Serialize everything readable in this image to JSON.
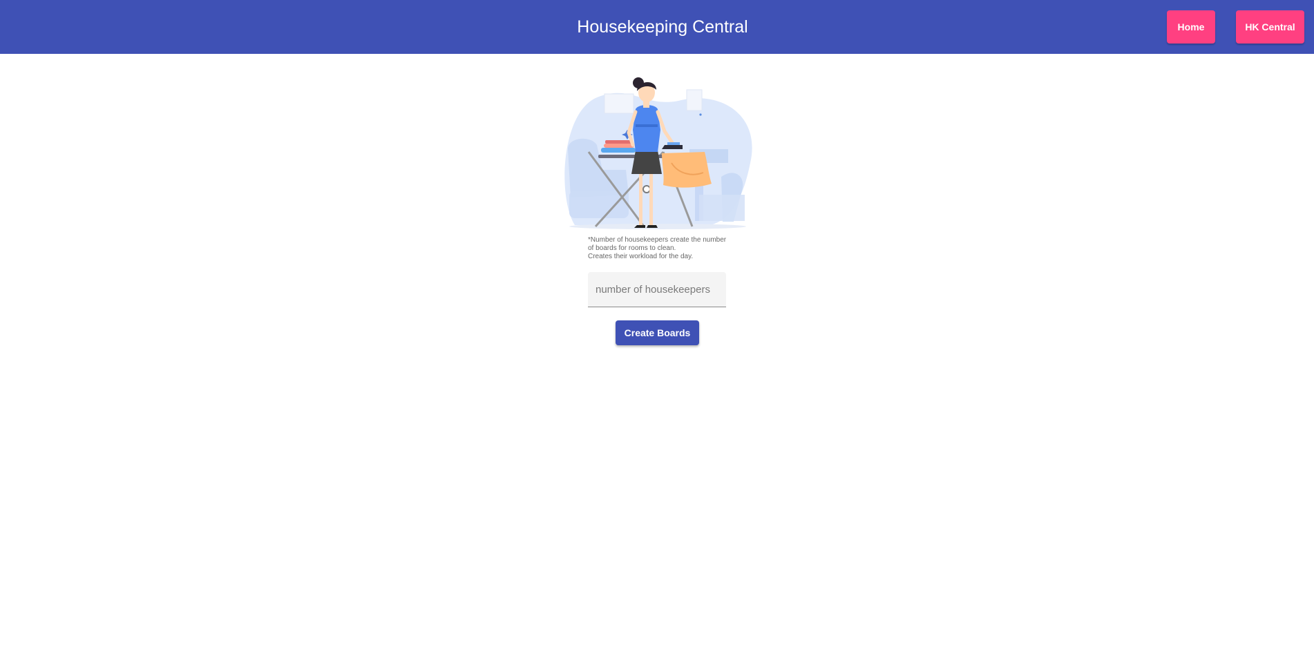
{
  "header": {
    "title": "Housekeeping Central",
    "nav": {
      "home_label": "Home",
      "hk_central_label": "HK Central"
    }
  },
  "main": {
    "illustration": {
      "subject": "housekeeper-ironing-illustration"
    },
    "note_lines": [
      "*Number of housekeepers create the number",
      "of boards for rooms to clean.",
      "Creates their workload for the day."
    ],
    "housekeepers_input": {
      "value": "",
      "placeholder": "number of housekeepers"
    },
    "create_button_label": "Create Boards"
  },
  "colors": {
    "primary": "#3f51b5",
    "accent": "#ff4081",
    "background": "#ffffff"
  }
}
